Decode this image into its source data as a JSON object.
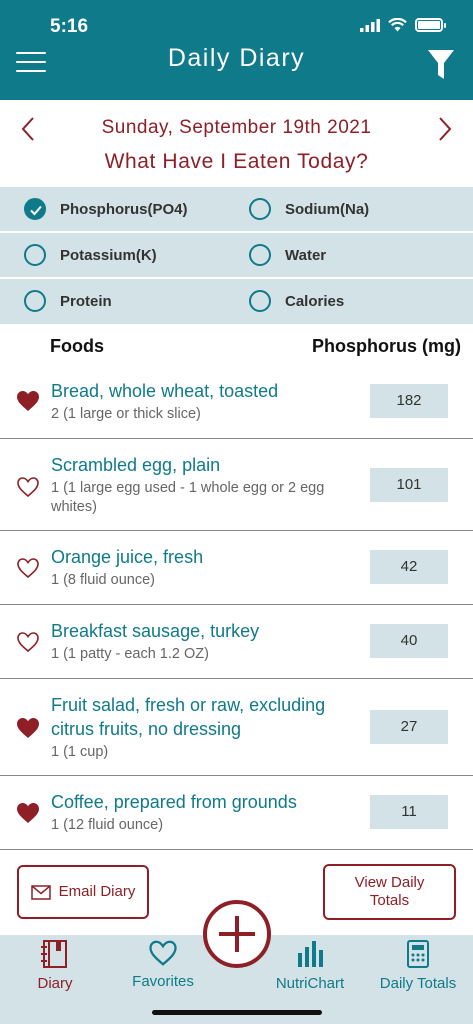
{
  "status": {
    "time": "5:16"
  },
  "header": {
    "title": "Daily Diary"
  },
  "date": {
    "label": "Sunday, September 19th 2021"
  },
  "question": "What Have I Eaten Today?",
  "filters": [
    {
      "label": "Phosphorus(PO4)",
      "checked": true
    },
    {
      "label": "Sodium(Na)",
      "checked": false
    },
    {
      "label": "Potassium(K)",
      "checked": false
    },
    {
      "label": "Water",
      "checked": false
    },
    {
      "label": "Protein",
      "checked": false
    },
    {
      "label": "Calories",
      "checked": false
    }
  ],
  "columns": {
    "foods": "Foods",
    "value": "Phosphorus (mg)"
  },
  "items": [
    {
      "name": "Bread, whole wheat, toasted",
      "qty": "2 (1 large or thick slice)",
      "value": "182",
      "favorite": true
    },
    {
      "name": "Scrambled egg, plain",
      "qty": "1 (1 large egg used - 1 whole egg or 2 egg whites)",
      "value": "101",
      "favorite": false
    },
    {
      "name": "Orange juice, fresh",
      "qty": "1 (8 fluid ounce)",
      "value": "42",
      "favorite": false
    },
    {
      "name": "Breakfast sausage, turkey",
      "qty": "1 (1 patty - each 1.2 OZ)",
      "value": "40",
      "favorite": false
    },
    {
      "name": "Fruit salad, fresh or raw,  excluding citrus fruits, no dressing",
      "qty": "1 (1 cup)",
      "value": "27",
      "favorite": true
    },
    {
      "name": "Coffee, prepared from grounds",
      "qty": "1 (12 fluid ounce)",
      "value": "11",
      "favorite": true
    }
  ],
  "actions": {
    "email": "Email Diary",
    "totals": "View Daily Totals"
  },
  "tabs": {
    "diary": "Diary",
    "favorites": "Favorites",
    "nutrichart": "NutriChart",
    "daily_totals": "Daily Totals"
  },
  "colors": {
    "teal": "#0f7a8a",
    "maroon": "#8e1f27",
    "panel": "#d3e2e6"
  }
}
